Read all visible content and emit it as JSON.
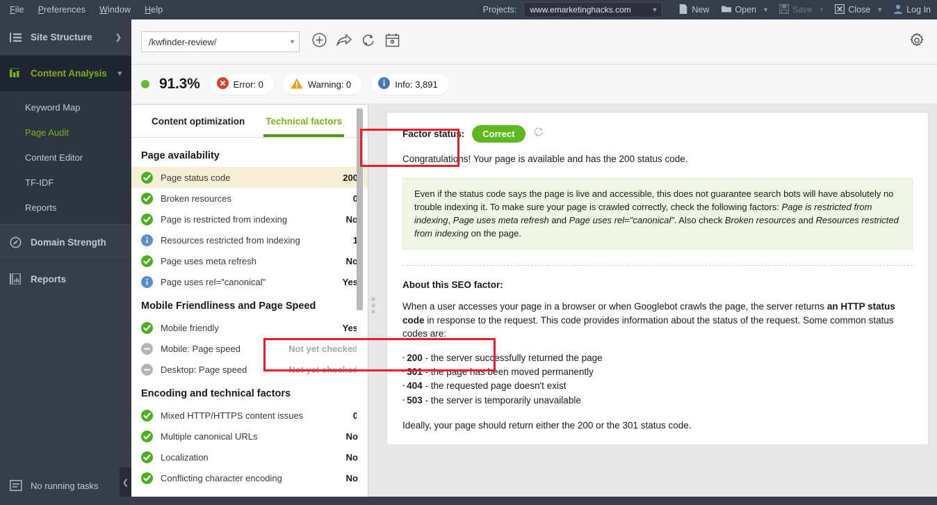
{
  "topbar": {
    "menu": [
      {
        "label": "File",
        "acc": "F"
      },
      {
        "label": "Preferences",
        "acc": "P"
      },
      {
        "label": "Window",
        "acc": "W"
      },
      {
        "label": "Help",
        "acc": "H"
      }
    ],
    "projects_label": "Projects:",
    "project_value": "www.emarketinghacks.com",
    "actions": [
      {
        "label": "New",
        "icon": "new-file-icon",
        "disabled": false,
        "caret": false
      },
      {
        "label": "Open",
        "icon": "open-folder-icon",
        "disabled": false,
        "caret": true
      },
      {
        "label": "Save",
        "icon": "save-disk-icon",
        "disabled": true,
        "caret": true
      },
      {
        "label": "Close",
        "icon": "close-x-icon",
        "disabled": false,
        "caret": true
      },
      {
        "label": "Log In",
        "icon": "user-icon",
        "disabled": false,
        "caret": false
      }
    ]
  },
  "sidebar": {
    "site_structure": "Site Structure",
    "content_analysis": "Content Analysis",
    "subitems": [
      {
        "label": "Keyword Map",
        "selected": false
      },
      {
        "label": "Page Audit",
        "selected": true
      },
      {
        "label": "Content Editor",
        "selected": false
      },
      {
        "label": "TF-IDF",
        "selected": false
      },
      {
        "label": "Reports",
        "selected": false
      }
    ],
    "domain_strength": "Domain Strength",
    "reports": "Reports",
    "tasks": "No running tasks",
    "accent_green": "#7ab317"
  },
  "urlbar": {
    "url": "/kwfinder-review/",
    "icons": [
      "add-circle-icon",
      "share-arrow-icon",
      "refresh-icon",
      "calendar-schedule-icon"
    ],
    "gear": "gear-icon"
  },
  "status": {
    "percent": "91.3%",
    "pills": [
      {
        "icon": "error-icon",
        "label": "Error: 0",
        "color": "#d9402a"
      },
      {
        "icon": "warning-icon",
        "label": "Warning: 0",
        "color": "#f2a01e"
      },
      {
        "icon": "info-icon",
        "label": "Info: 3,891",
        "color": "#4a78b5"
      }
    ]
  },
  "tabs": [
    {
      "label": "Content optimization",
      "active": false
    },
    {
      "label": "Technical factors",
      "active": true
    }
  ],
  "factor_list": [
    {
      "section": "Page availability",
      "rows": [
        {
          "status": "ok",
          "label": "Page status code",
          "value": "200",
          "highlight": true,
          "muted": false
        },
        {
          "status": "ok",
          "label": "Broken resources",
          "value": "0",
          "highlight": false,
          "muted": false
        },
        {
          "status": "ok",
          "label": "Page is restricted from indexing",
          "value": "No",
          "highlight": false,
          "muted": false
        },
        {
          "status": "info",
          "label": "Resources restricted from indexing",
          "value": "1",
          "highlight": false,
          "muted": false
        },
        {
          "status": "ok",
          "label": "Page uses meta refresh",
          "value": "No",
          "highlight": false,
          "muted": false
        },
        {
          "status": "info",
          "label": "Page uses rel=\"canonical\"",
          "value": "Yes",
          "highlight": false,
          "muted": false
        }
      ]
    },
    {
      "section": "Mobile Friendliness and Page Speed",
      "rows": [
        {
          "status": "ok",
          "label": "Mobile friendly",
          "value": "Yes",
          "highlight": false,
          "muted": false
        },
        {
          "status": "neutral",
          "label": "Mobile: Page speed",
          "value": "Not yet checked",
          "highlight": false,
          "muted": true
        },
        {
          "status": "neutral",
          "label": "Desktop: Page speed",
          "value": "Not yet checked",
          "highlight": false,
          "muted": true
        }
      ]
    },
    {
      "section": "Encoding and technical factors",
      "rows": [
        {
          "status": "ok",
          "label": "Mixed HTTP/HTTPS content issues",
          "value": "0",
          "highlight": false,
          "muted": false
        },
        {
          "status": "ok",
          "label": "Multiple canonical URLs",
          "value": "No",
          "highlight": false,
          "muted": false
        },
        {
          "status": "ok",
          "label": "Localization",
          "value": "No",
          "highlight": false,
          "muted": false
        },
        {
          "status": "ok",
          "label": "Conflicting character encoding",
          "value": "No",
          "highlight": false,
          "muted": false
        }
      ]
    }
  ],
  "detail": {
    "factor_status_label": "Factor status:",
    "factor_status_value": "Correct",
    "refresh_icon": "refresh-icon",
    "congrats": "Congratulations! Your page is available and has the 200 status code.",
    "greenbox_html": "Even if the status code says the page is live and accessible, this does not guarantee search bots will have absolutely no trouble indexing it. To make sure your page is crawled correctly, check the following factors: <em>Page is restricted from indexing</em>, <em>Page uses meta refresh</em> and <em>Page uses rel=\"canonical\"</em>. Also check <em>Broken resources</em> and <em>Resources restricted from indexing</em> on the page.",
    "about_heading": "About this SEO factor:",
    "about_html": "When a user accesses your page in a browser or when Googlebot crawls the page, the server returns <b>an HTTP status code</b> in response to the request. This code provides information about the status of the request. Some common status codes are:",
    "codes": [
      {
        "code": "200",
        "text": " - the server successfully returned the page"
      },
      {
        "code": "301",
        "text": " - the page has been moved permanently"
      },
      {
        "code": "404",
        "text": " - the requested page doesn't exist"
      },
      {
        "code": "503",
        "text": " - the server is temporarily unavailable"
      }
    ],
    "closing": "Ideally, your page should return either the 200 or the 301 status code."
  },
  "annotations": {
    "color": "#ee1c25",
    "boxes": [
      "technical-factors-tab",
      "mobile-friendly-row"
    ]
  }
}
